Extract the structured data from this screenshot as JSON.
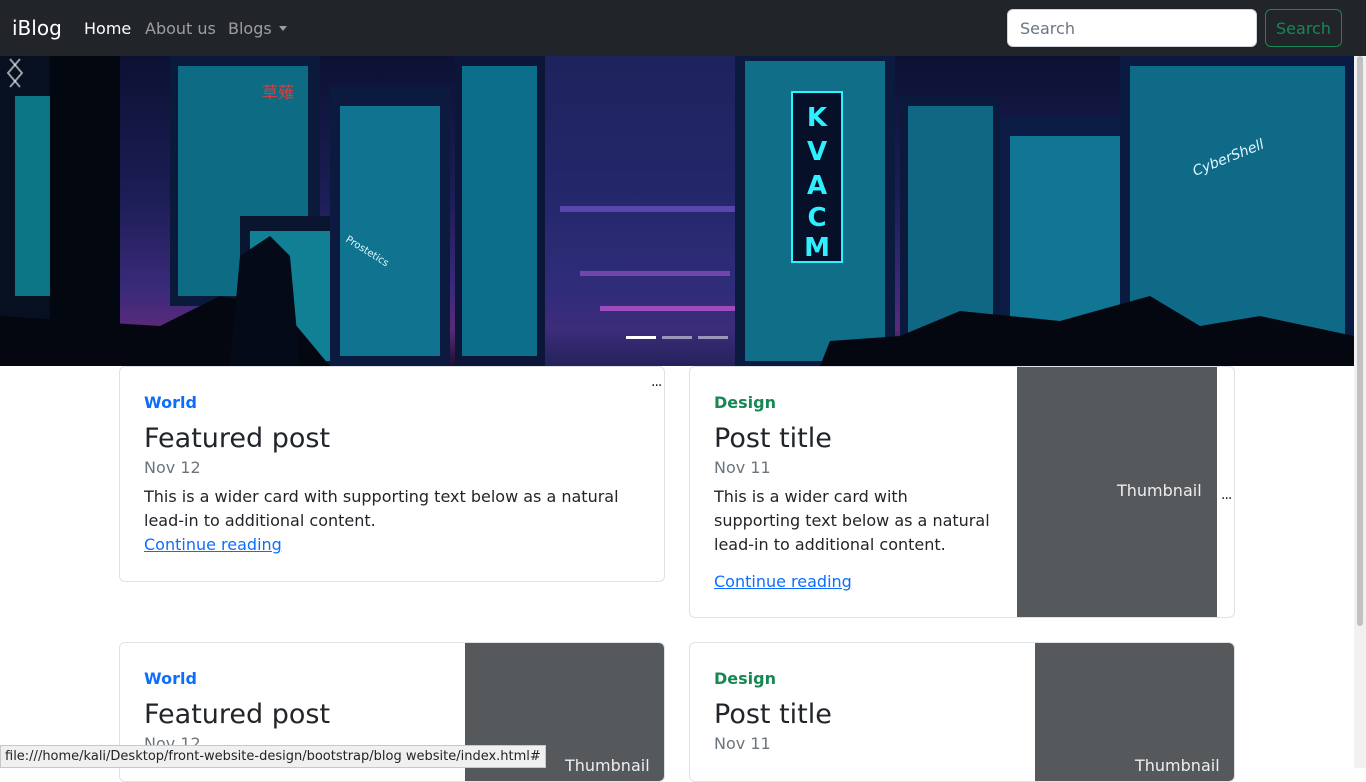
{
  "navbar": {
    "brand": "iBlog",
    "links": [
      {
        "label": "Home",
        "active": true
      },
      {
        "label": "About us",
        "active": false
      },
      {
        "label": "Blogs",
        "active": false
      }
    ],
    "search_placeholder": "Search",
    "search_button": "Search"
  },
  "hero": {
    "signs": [
      "KVACM",
      "CyberShell",
      "Prostetics",
      "草薙"
    ],
    "slide_count": 3,
    "active_slide": 1
  },
  "cards": [
    {
      "category": "World",
      "title": "Featured post",
      "date": "Nov 12",
      "text": "This is a wider card with supporting text below as a natural lead-in to additional content.",
      "link": "Continue reading"
    },
    {
      "category": "Design",
      "title": "Post title",
      "date": "Nov 11",
      "text": "This is a wider card with supporting text below as a natural lead-in to additional content.",
      "link": "Continue reading",
      "thumbnail": "Thumbnail"
    },
    {
      "category": "World",
      "title": "Featured post",
      "date": "Nov 12",
      "thumbnail": "Thumbnail"
    },
    {
      "category": "Design",
      "title": "Post title",
      "date": "Nov 11",
      "thumbnail": "Thumbnail"
    }
  ],
  "ellipsis": "...",
  "status_url": "file:///home/kali/Desktop/front-website-design/bootstrap/blog website/index.html#",
  "colors": {
    "navbar": "#212529",
    "accent_blue": "#0d6efd",
    "accent_green": "#198754",
    "thumb": "#55595c"
  }
}
